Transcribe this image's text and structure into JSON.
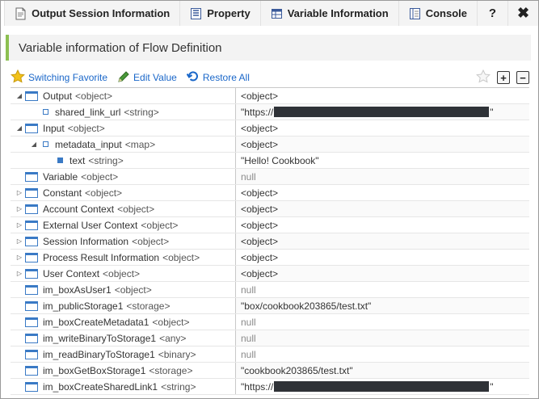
{
  "tabs": [
    {
      "label": "Output Session Information",
      "icon": "document-icon"
    },
    {
      "label": "Property",
      "icon": "property-icon"
    },
    {
      "label": "Variable Information",
      "icon": "variable-icon"
    },
    {
      "label": "Console",
      "icon": "console-icon"
    }
  ],
  "help_label": "?",
  "close_label": "✖",
  "header": {
    "title": "Variable information of Flow Definition"
  },
  "toolbar": {
    "switching_favorite": "Switching Favorite",
    "edit_value": "Edit Value",
    "restore_all": "Restore All",
    "add_label": "+",
    "remove_label": "−"
  },
  "rows": [
    {
      "name": "Output",
      "type": "<object>",
      "value": "<object>",
      "indent": 0,
      "expander": "open",
      "icon": "table",
      "vstyle": "obj"
    },
    {
      "name": "shared_link_url",
      "type": "<string>",
      "value_prefix": "\"https://",
      "value_suffix": "\"",
      "redacted": true,
      "indent": 1,
      "expander": "none",
      "icon": "bullet",
      "vstyle": "obj"
    },
    {
      "name": "Input",
      "type": "<object>",
      "value": "<object>",
      "indent": 0,
      "expander": "open",
      "icon": "table",
      "vstyle": "obj"
    },
    {
      "name": "metadata_input",
      "type": "<map>",
      "value": "<object>",
      "indent": 1,
      "expander": "open",
      "icon": "bullet",
      "vstyle": "obj"
    },
    {
      "name": "text",
      "type": "<string>",
      "value": "\"Hello! Cookbook\"",
      "indent": 2,
      "expander": "none",
      "icon": "bullet-filled",
      "vstyle": "obj"
    },
    {
      "name": "Variable",
      "type": "<object>",
      "value": "null",
      "indent": 0,
      "expander": "none",
      "icon": "table",
      "vstyle": "null"
    },
    {
      "name": "Constant",
      "type": "<object>",
      "value": "<object>",
      "indent": 0,
      "expander": "closed",
      "icon": "table",
      "vstyle": "obj"
    },
    {
      "name": "Account Context",
      "type": "<object>",
      "value": "<object>",
      "indent": 0,
      "expander": "closed",
      "icon": "table",
      "vstyle": "obj"
    },
    {
      "name": "External User Context",
      "type": "<object>",
      "value": "<object>",
      "indent": 0,
      "expander": "closed",
      "icon": "table",
      "vstyle": "obj"
    },
    {
      "name": "Session Information",
      "type": "<object>",
      "value": "<object>",
      "indent": 0,
      "expander": "closed",
      "icon": "table",
      "vstyle": "obj"
    },
    {
      "name": "Process Result Information",
      "type": "<object>",
      "value": "<object>",
      "indent": 0,
      "expander": "closed",
      "icon": "table",
      "vstyle": "obj"
    },
    {
      "name": "User Context",
      "type": "<object>",
      "value": "<object>",
      "indent": 0,
      "expander": "closed",
      "icon": "table",
      "vstyle": "obj"
    },
    {
      "name": "im_boxAsUser1",
      "type": "<object>",
      "value": "null",
      "indent": 0,
      "expander": "none",
      "icon": "table",
      "vstyle": "null"
    },
    {
      "name": "im_publicStorage1",
      "type": "<storage>",
      "value": "\"box/cookbook203865/test.txt\"",
      "indent": 0,
      "expander": "none",
      "icon": "table",
      "vstyle": "obj"
    },
    {
      "name": "im_boxCreateMetadata1",
      "type": "<object>",
      "value": "null",
      "indent": 0,
      "expander": "none",
      "icon": "table",
      "vstyle": "null"
    },
    {
      "name": "im_writeBinaryToStorage1",
      "type": "<any>",
      "value": "null",
      "indent": 0,
      "expander": "none",
      "icon": "table",
      "vstyle": "null"
    },
    {
      "name": "im_readBinaryToStorage1",
      "type": "<binary>",
      "value": "null",
      "indent": 0,
      "expander": "none",
      "icon": "table",
      "vstyle": "null"
    },
    {
      "name": "im_boxGetBoxStorage1",
      "type": "<storage>",
      "value": "\"cookbook203865/test.txt\"",
      "indent": 0,
      "expander": "none",
      "icon": "table",
      "vstyle": "obj"
    },
    {
      "name": "im_boxCreateSharedLink1",
      "type": "<string>",
      "value_prefix": "\"https://",
      "value_suffix": "\"",
      "redacted": true,
      "indent": 0,
      "expander": "none",
      "icon": "table",
      "vstyle": "obj"
    }
  ]
}
